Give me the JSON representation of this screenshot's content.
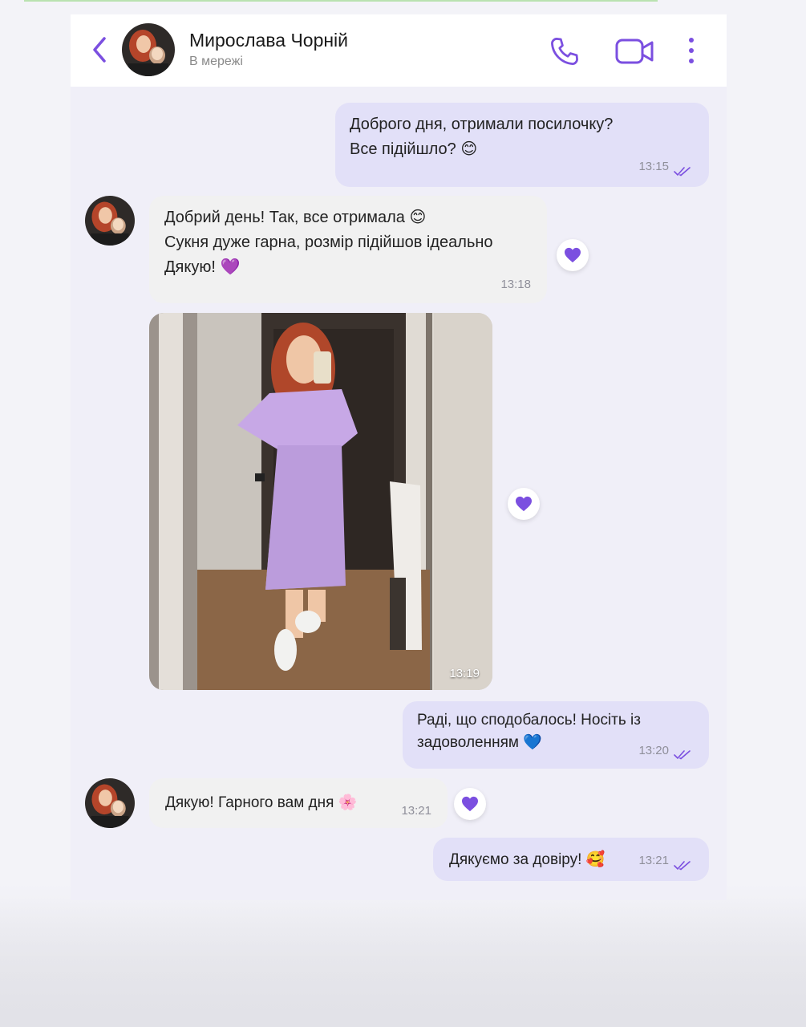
{
  "header": {
    "contact_name": "Мирослава Чорній",
    "status": "В мережі"
  },
  "colors": {
    "accent": "#7b4fe0",
    "outgoing_bubble": "#e2e0f8",
    "incoming_bubble": "#f1f1f1",
    "header_bg": "#ffffff"
  },
  "messages": [
    {
      "direction": "out",
      "text": "Доброго дня, отримали посилочку?\nВсе підійшло? 😊",
      "time": "13:15",
      "read": true
    },
    {
      "direction": "in",
      "text": "Добрий день! Так, все отримала 😊\nСукня дуже гарна, розмір підійшов ідеально\nДякую! 💜",
      "time": "13:18",
      "liked": true
    },
    {
      "direction": "in",
      "type": "photo",
      "time": "13:19",
      "liked": true
    },
    {
      "direction": "out",
      "text": "Раді, що сподобалось! Носіть із\nзадоволенням 💙",
      "time": "13:20",
      "read": true
    },
    {
      "direction": "in",
      "text": "Дякую! Гарного вам дня 🌸",
      "time": "13:21",
      "liked": true
    },
    {
      "direction": "out",
      "text": "Дякуємо за довіру! 🥰",
      "time": "13:21",
      "read": true
    }
  ],
  "icons": {
    "back": "chevron-left-icon",
    "call": "phone-icon",
    "video": "video-camera-icon",
    "menu": "more-vertical-icon",
    "like": "heart-icon",
    "read": "double-check-icon"
  }
}
